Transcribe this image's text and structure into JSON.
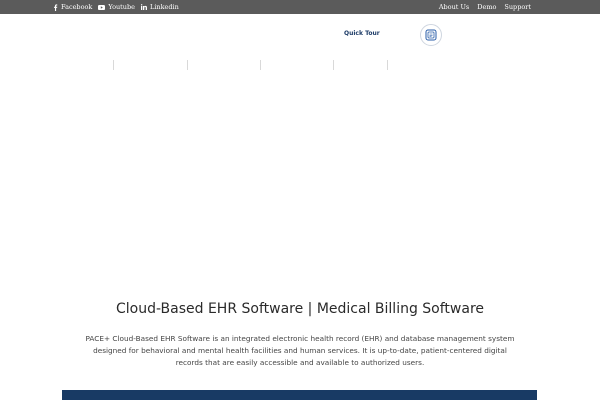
{
  "topbar": {
    "social": [
      {
        "label": "Facebook",
        "icon": "facebook-icon"
      },
      {
        "label": "Youtube",
        "icon": "youtube-icon"
      },
      {
        "label": "Linkedin",
        "icon": "linkedin-icon"
      }
    ],
    "links": [
      "About Us",
      "Demo",
      "Support"
    ]
  },
  "header": {
    "quick_tour": "Quick Tour",
    "icon": "ehr-chip-icon"
  },
  "hero": {
    "title": "Cloud-Based EHR Software | Medical Billing Software",
    "description": "PACE+ Cloud-Based EHR Software is an integrated electronic health record (EHR) and database management system designed for behavioral and mental health facilities and human services. It is up-to-date, patient-centered digital records that are easily accessible and available to authorized users."
  },
  "colors": {
    "topbar_bg": "#5b5b5b",
    "brand_navy": "#183a64",
    "link_navy": "#1b3a66"
  }
}
